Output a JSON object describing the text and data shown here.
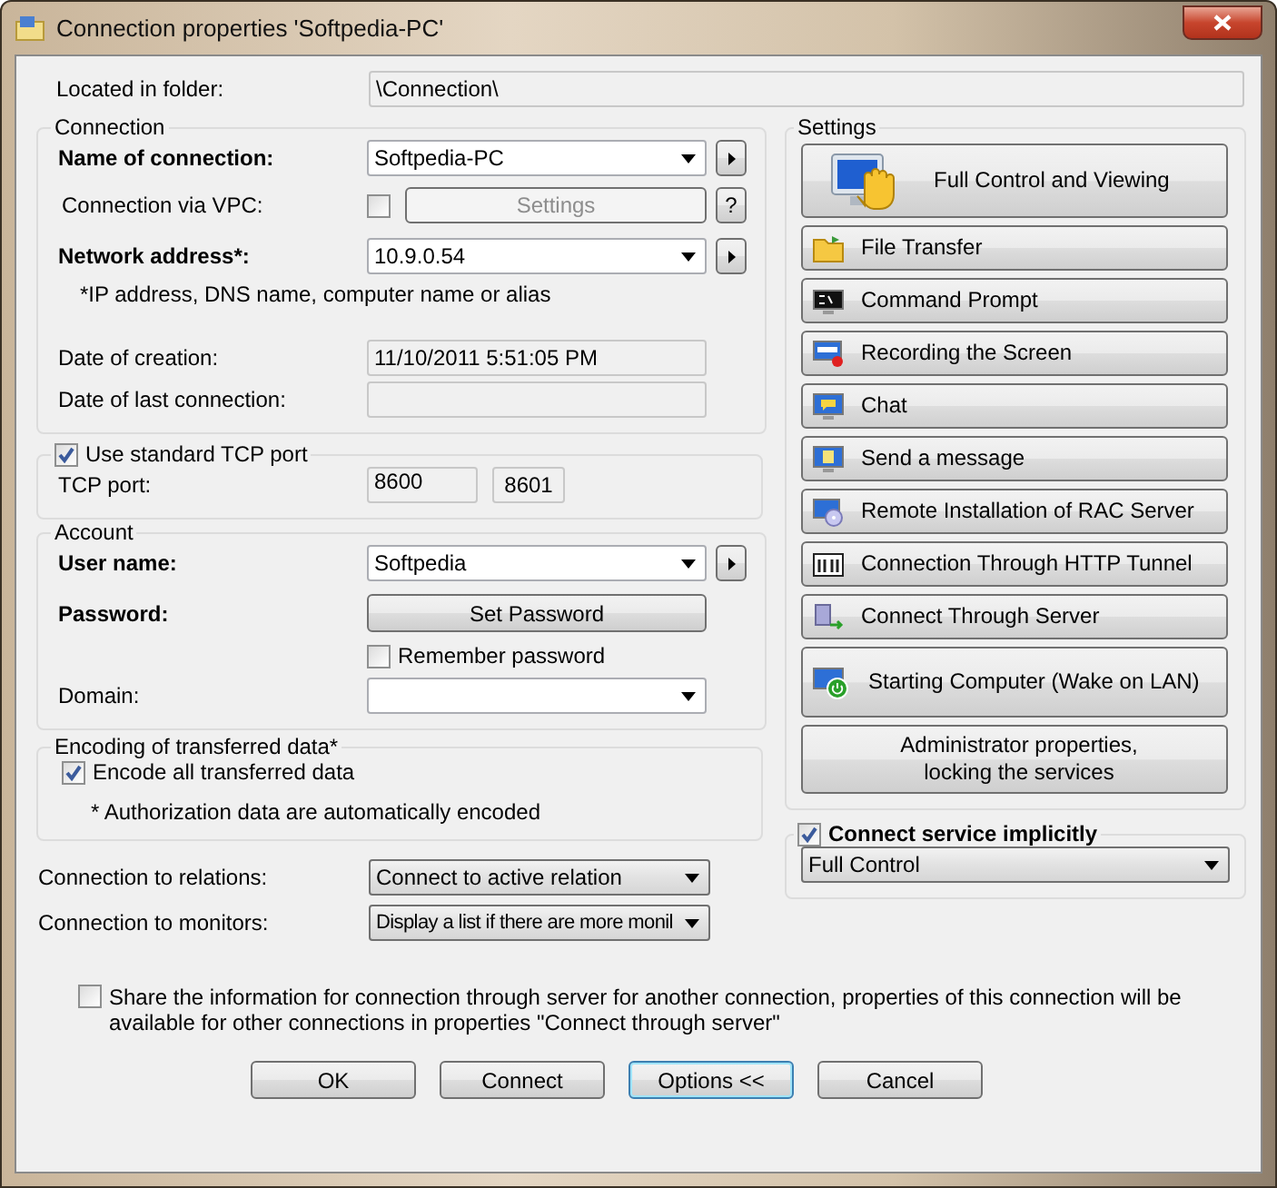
{
  "window": {
    "title": "Connection properties 'Softpedia-PC'"
  },
  "folder": {
    "label": "Located in folder:",
    "value": "\\Connection\\"
  },
  "connection": {
    "title": "Connection",
    "name": {
      "label": "Name of connection:",
      "bold": true,
      "value": "Softpedia-PC"
    },
    "vpc": {
      "label": "Connection via VPC:",
      "checked": false,
      "button": "Settings",
      "disabled": true,
      "help": "?"
    },
    "address": {
      "label": "Network address*:",
      "bold": true,
      "value": "10.9.0.54"
    },
    "hint": "*IP address, DNS name, computer name or alias",
    "created": {
      "label": "Date of creation:",
      "value": "11/10/2011 5:51:05 PM"
    },
    "last": {
      "label": "Date of last connection:"
    }
  },
  "tcp": {
    "label": "Use standard TCP port",
    "checked": true,
    "port_label": "TCP port:",
    "ports": [
      "8600",
      "8601"
    ]
  },
  "account": {
    "title": "Account",
    "user": {
      "label": "User name:",
      "bold": true,
      "value": "Softpedia"
    },
    "password": {
      "label": "Password:",
      "bold": true,
      "button": "Set Password"
    },
    "remember": {
      "label": "Remember password",
      "checked": false
    },
    "domain": {
      "label": "Domain:",
      "bold": false
    }
  },
  "encoding": {
    "title": "Encoding of transferred data*",
    "option": {
      "label": "Encode all transferred data",
      "checked": true
    },
    "note": "* Authorization data are automatically encoded"
  },
  "relations": {
    "label": "Connection to relations:",
    "value": "Connect to active relation"
  },
  "monitors": {
    "label": "Connection to monitors:",
    "value": "Display a list if there are more monil"
  },
  "share": {
    "checked": false,
    "text": "Share the information for connection through server for another connection, properties of this connection will be available for other connections in properties \"Connect through server\""
  },
  "settings": {
    "title": "Settings",
    "services": [
      {
        "kind": "large",
        "label": "Full Control and Viewing"
      },
      {
        "kind": "small",
        "label": "File Transfer"
      },
      {
        "kind": "small",
        "label": "Command Prompt"
      },
      {
        "kind": "small",
        "label": "Recording the Screen"
      },
      {
        "kind": "small",
        "label": "Chat"
      },
      {
        "kind": "small",
        "label": "Send a message"
      },
      {
        "kind": "small",
        "label": "Remote Installation of RAC Server"
      },
      {
        "kind": "small",
        "label": "Connection Through HTTP Tunnel"
      },
      {
        "kind": "small",
        "label": "Connect Through Server"
      },
      {
        "kind": "tall",
        "label": "Starting Computer (Wake on LAN)"
      },
      {
        "kind": "text",
        "label": "Administrator properties,\nlocking the services"
      }
    ]
  },
  "implicit": {
    "label": "Connect service implicitly",
    "checked": true,
    "value": "Full Control"
  },
  "buttons": [
    {
      "label": "OK",
      "selected": false
    },
    {
      "label": "Connect",
      "selected": false
    },
    {
      "label": "Options <<",
      "selected": true
    },
    {
      "label": "Cancel",
      "selected": false
    }
  ]
}
